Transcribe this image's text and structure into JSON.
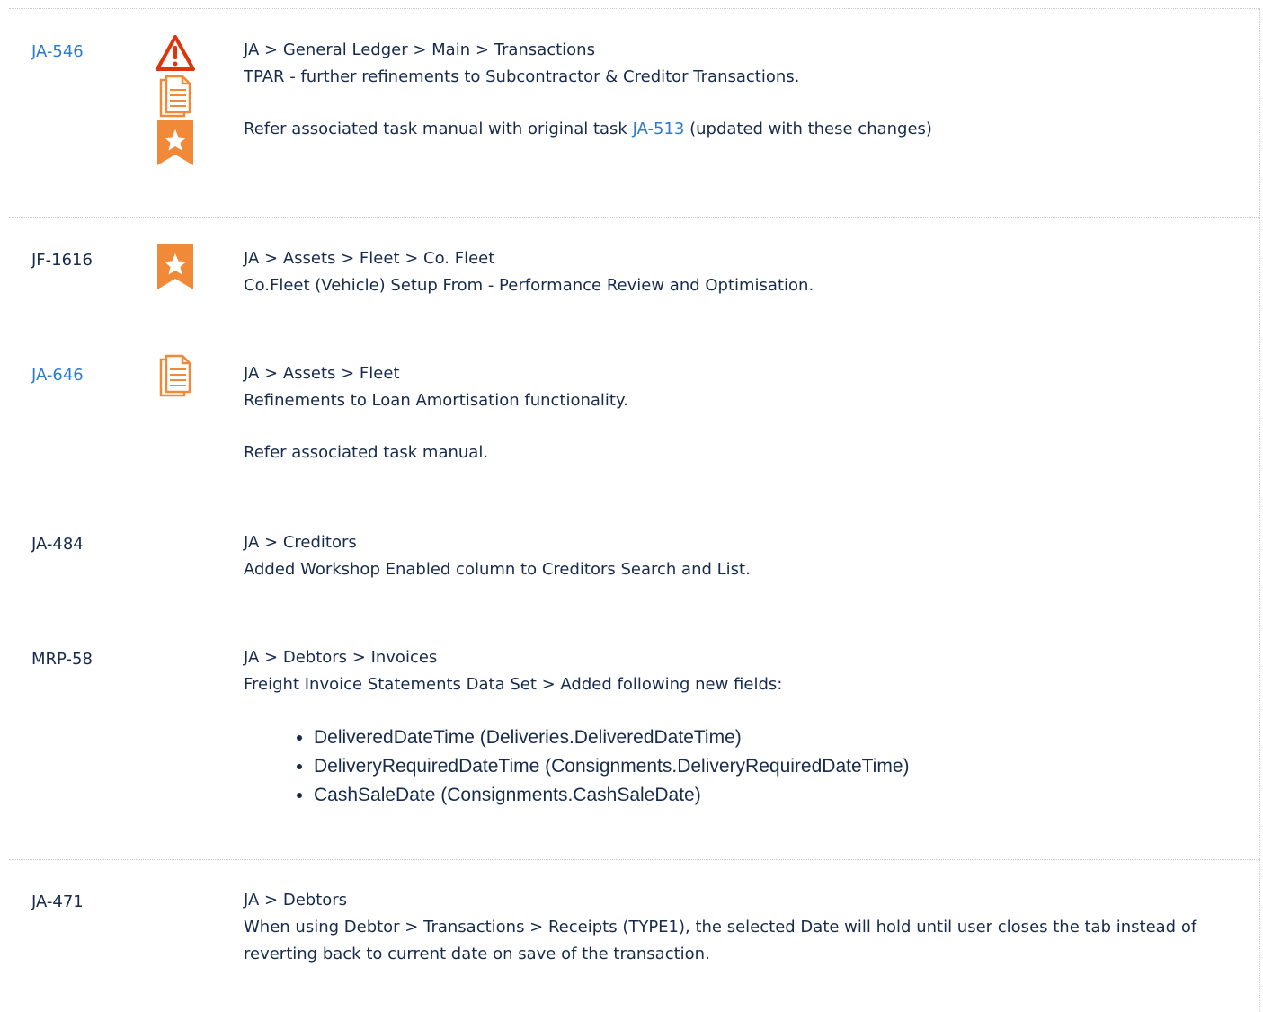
{
  "rows": [
    {
      "key": "JA-546",
      "key_is_link": true,
      "icons": [
        "warning-icon",
        "document-icon",
        "star-badge-icon"
      ],
      "path": "JA > General Ledger > Main > Transactions",
      "summary": "TPAR - further refinements to Subcontractor & Creditor Transactions.",
      "note_prefix": "Refer associated task manual with original task ",
      "note_link": "JA-513",
      "note_suffix": " (updated with these changes)"
    },
    {
      "key": "JF-1616",
      "key_is_link": false,
      "icons": [
        "star-badge-icon"
      ],
      "path": "JA > Assets > Fleet > Co. Fleet",
      "summary": "Co.Fleet (Vehicle) Setup From - Performance Review and Optimisation."
    },
    {
      "key": "JA-646",
      "key_is_link": true,
      "icons": [
        "document-icon"
      ],
      "path": "JA > Assets > Fleet",
      "summary": "Refinements to Loan Amortisation functionality.",
      "note": "Refer associated task manual."
    },
    {
      "key": "JA-484",
      "key_is_link": false,
      "path": "JA > Creditors",
      "summary": "Added Workshop Enabled column to Creditors Search and List."
    },
    {
      "key": "MRP-58",
      "key_is_link": false,
      "path": "JA > Debtors > Invoices",
      "summary": "Freight Invoice Statements Data Set > Added following new fields:",
      "fields": [
        "DeliveredDateTime (Deliveries.DeliveredDateTime)",
        "DeliveryRequiredDateTime (Consignments.DeliveryRequiredDateTime)",
        "CashSaleDate (Consignments.CashSaleDate)"
      ]
    },
    {
      "key": "JA-471",
      "key_is_link": false,
      "path": "JA > Debtors",
      "summary": "When using Debtor > Transactions > Receipts (TYPE1), the selected Date will hold until user closes the tab instead of reverting back to current date on save of the transaction."
    }
  ],
  "colors": {
    "link": "#2b7bd0",
    "warning": "#de350b",
    "icon_orange": "#f08a38"
  }
}
